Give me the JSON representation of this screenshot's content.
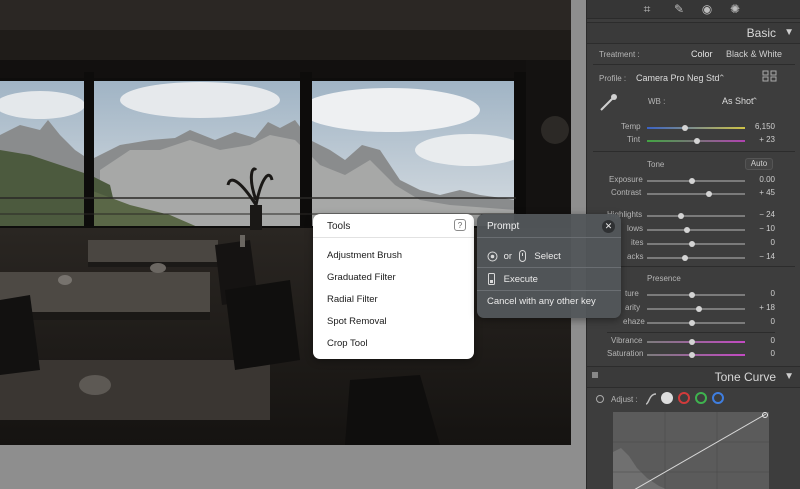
{
  "panel": {
    "basic": {
      "title": "Basic",
      "treatment_label": "Treatment :",
      "treatment_options": [
        "Color",
        "Black & White"
      ],
      "profile_label": "Profile :",
      "profile_value": "Camera Pro Neg Std",
      "wb_label": "WB :",
      "wb_value": "As Shot",
      "temp_label": "Temp",
      "temp_value": "6,150",
      "tint_label": "Tint",
      "tint_value": "+ 23",
      "tone_label": "Tone",
      "auto_label": "Auto",
      "exposure_label": "Exposure",
      "exposure_value": "0.00",
      "contrast_label": "Contrast",
      "contrast_value": "+ 45",
      "highlights_label": "Highlights",
      "highlights_value": "− 24",
      "shadows_label": "lows",
      "shadows_value": "− 10",
      "whites_label": "ites",
      "whites_value": "0",
      "blacks_label": "acks",
      "blacks_value": "− 14",
      "presence_label": "Presence",
      "texture_label": "ture",
      "texture_value": "0",
      "clarity_label": "arity",
      "clarity_value": "+ 18",
      "dehaze_label": "ehaze",
      "dehaze_value": "0",
      "vibrance_label": "Vibrance",
      "vibrance_value": "0",
      "saturation_label": "Saturation",
      "saturation_value": "0"
    },
    "tone_curve": {
      "title": "Tone Curve",
      "adjust_label": "Adjust :"
    },
    "icons": [
      "crop-icon",
      "heal-icon",
      "red-eye-icon",
      "masking-icon"
    ]
  },
  "tools_popup": {
    "title": "Tools",
    "help_glyph": "?",
    "items": [
      "Adjustment Brush",
      "Graduated Filter",
      "Radial Filter",
      "Spot Removal",
      "Crop Tool"
    ]
  },
  "prompt_popup": {
    "title": "Prompt",
    "close_glyph": "✕",
    "select_or": "or",
    "select_label": "Select",
    "execute_label": "Execute",
    "cancel_label": "Cancel with any other key"
  },
  "colors": {
    "panel_bg": "#3d3d3d",
    "popup_light": "#ffffff",
    "popup_dark": "#52565a"
  }
}
